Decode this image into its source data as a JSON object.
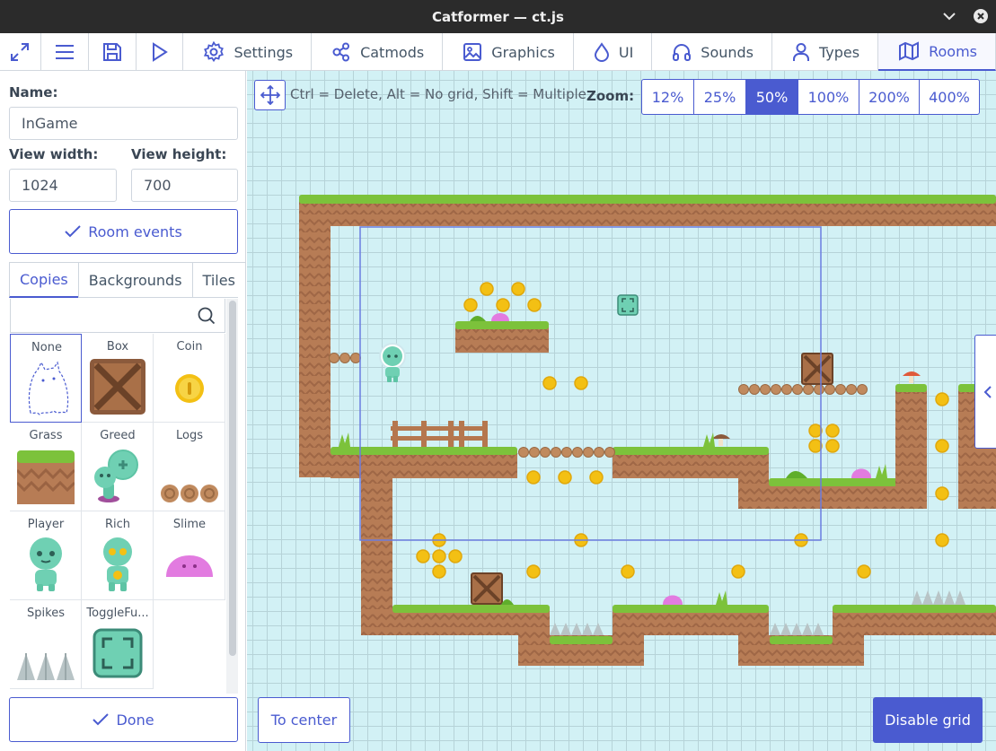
{
  "window": {
    "title": "Catformer — ct.js"
  },
  "toolbar": {
    "tabs": [
      {
        "label": "Settings",
        "icon": "gear-icon"
      },
      {
        "label": "Catmods",
        "icon": "share-nodes-icon"
      },
      {
        "label": "Graphics",
        "icon": "image-icon"
      },
      {
        "label": "UI",
        "icon": "droplet-icon"
      },
      {
        "label": "Sounds",
        "icon": "headphones-icon"
      },
      {
        "label": "Types",
        "icon": "user-icon"
      },
      {
        "label": "Rooms",
        "icon": "map-icon"
      }
    ],
    "active_tab": "Rooms"
  },
  "room": {
    "name_label": "Name:",
    "name_value": "InGame",
    "view_width_label": "View width:",
    "view_width_value": "1024",
    "view_height_label": "View height:",
    "view_height_value": "700",
    "events_button": "Room events"
  },
  "panel": {
    "tabs": [
      "Copies",
      "Backgrounds",
      "Tiles"
    ],
    "active_tab": "Copies",
    "search_value": "",
    "types": [
      "None",
      "Box",
      "Coin",
      "Grass",
      "Greed",
      "Logs",
      "Player",
      "Rich",
      "Slime",
      "Spikes",
      "ToggleFu..."
    ],
    "selected_type": "None",
    "done_button": "Done"
  },
  "editor": {
    "hint": "Ctrl = Delete, Alt = No grid, Shift = Multiple",
    "zoom_label": "Zoom:",
    "zoom_options": [
      "12%",
      "25%",
      "50%",
      "100%",
      "200%",
      "400%"
    ],
    "zoom_active": "50%",
    "to_center_button": "To center",
    "grid_button": "Disable grid"
  },
  "colors": {
    "accent": "#4a5bd0",
    "canvas_bg": "#d2f1f5",
    "grass": "#7cc23b",
    "dirt": "#b77c55",
    "coin": "#f3c014"
  }
}
